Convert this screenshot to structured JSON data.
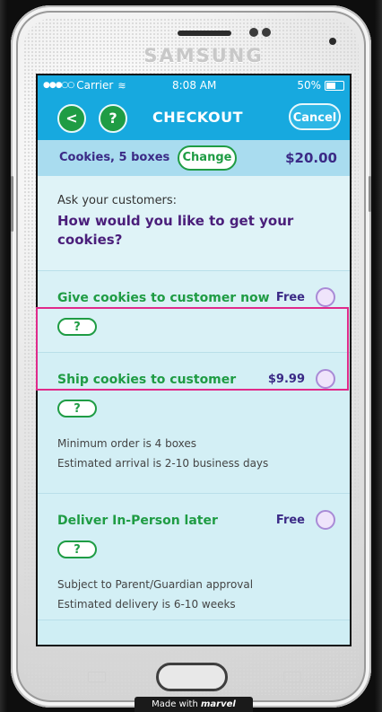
{
  "device": {
    "brand": "SAMSUNG"
  },
  "status_bar": {
    "signal_dots": "●●●○○",
    "carrier": "Carrier",
    "time": "8:08 AM",
    "battery": "50%"
  },
  "nav": {
    "back_label": "<",
    "help_label": "?",
    "title": "CHECKOUT",
    "cancel_label": "Cancel"
  },
  "summary": {
    "order": "Cookies, 5 boxes",
    "change_label": "Change",
    "total": "$20.00"
  },
  "question": {
    "prompt": "Ask your customers:",
    "text": "How would you like to get your cookies?"
  },
  "options": [
    {
      "title": "Give cookies to customer now",
      "price": "Free",
      "help": "?",
      "lines": []
    },
    {
      "title": "Ship cookies to customer",
      "price": "$9.99",
      "help": "?",
      "lines": [
        "Minimum order is 4 boxes",
        "Estimated arrival is 2-10 business days"
      ]
    },
    {
      "title": "Deliver In-Person later",
      "price": "Free",
      "help": "?",
      "lines": [
        "Subject to Parent/Guardian approval",
        "Estimated delivery is 6-10 weeks"
      ]
    }
  ],
  "footer": {
    "made_with": "Made with",
    "logo": "marvel"
  },
  "colors": {
    "header_blue": "#17a9df",
    "green": "#1f9c44",
    "purple": "#3b2a86",
    "highlight": "#e02a8a"
  }
}
